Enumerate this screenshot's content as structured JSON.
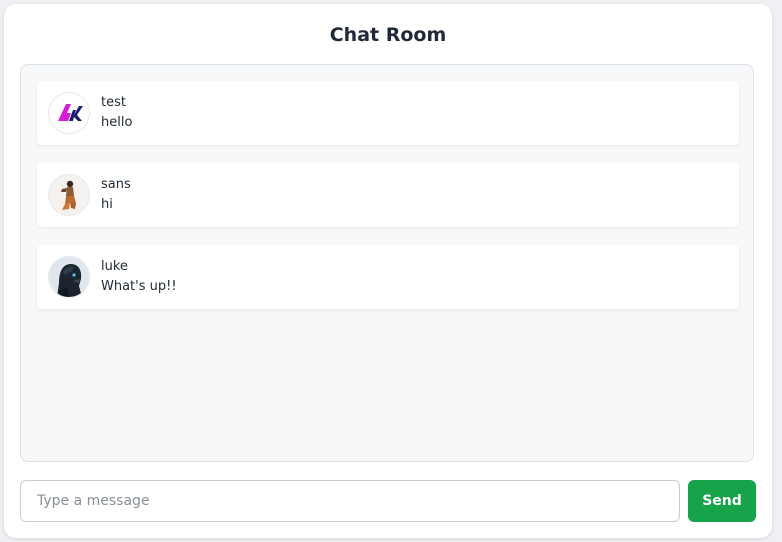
{
  "header": {
    "title": "Chat Room"
  },
  "messages": [
    {
      "username": "test",
      "text": "hello",
      "avatar_icon": "ak-logo-avatar"
    },
    {
      "username": "sans",
      "text": "hi",
      "avatar_icon": "person-photo-avatar"
    },
    {
      "username": "luke",
      "text": "What's up!!",
      "avatar_icon": "robot-head-avatar"
    }
  ],
  "composer": {
    "placeholder": "Type a message",
    "value": "",
    "send_label": "Send"
  },
  "colors": {
    "accent": "#16a34a",
    "background": "#f7f8fa",
    "text": "#1f2937"
  }
}
